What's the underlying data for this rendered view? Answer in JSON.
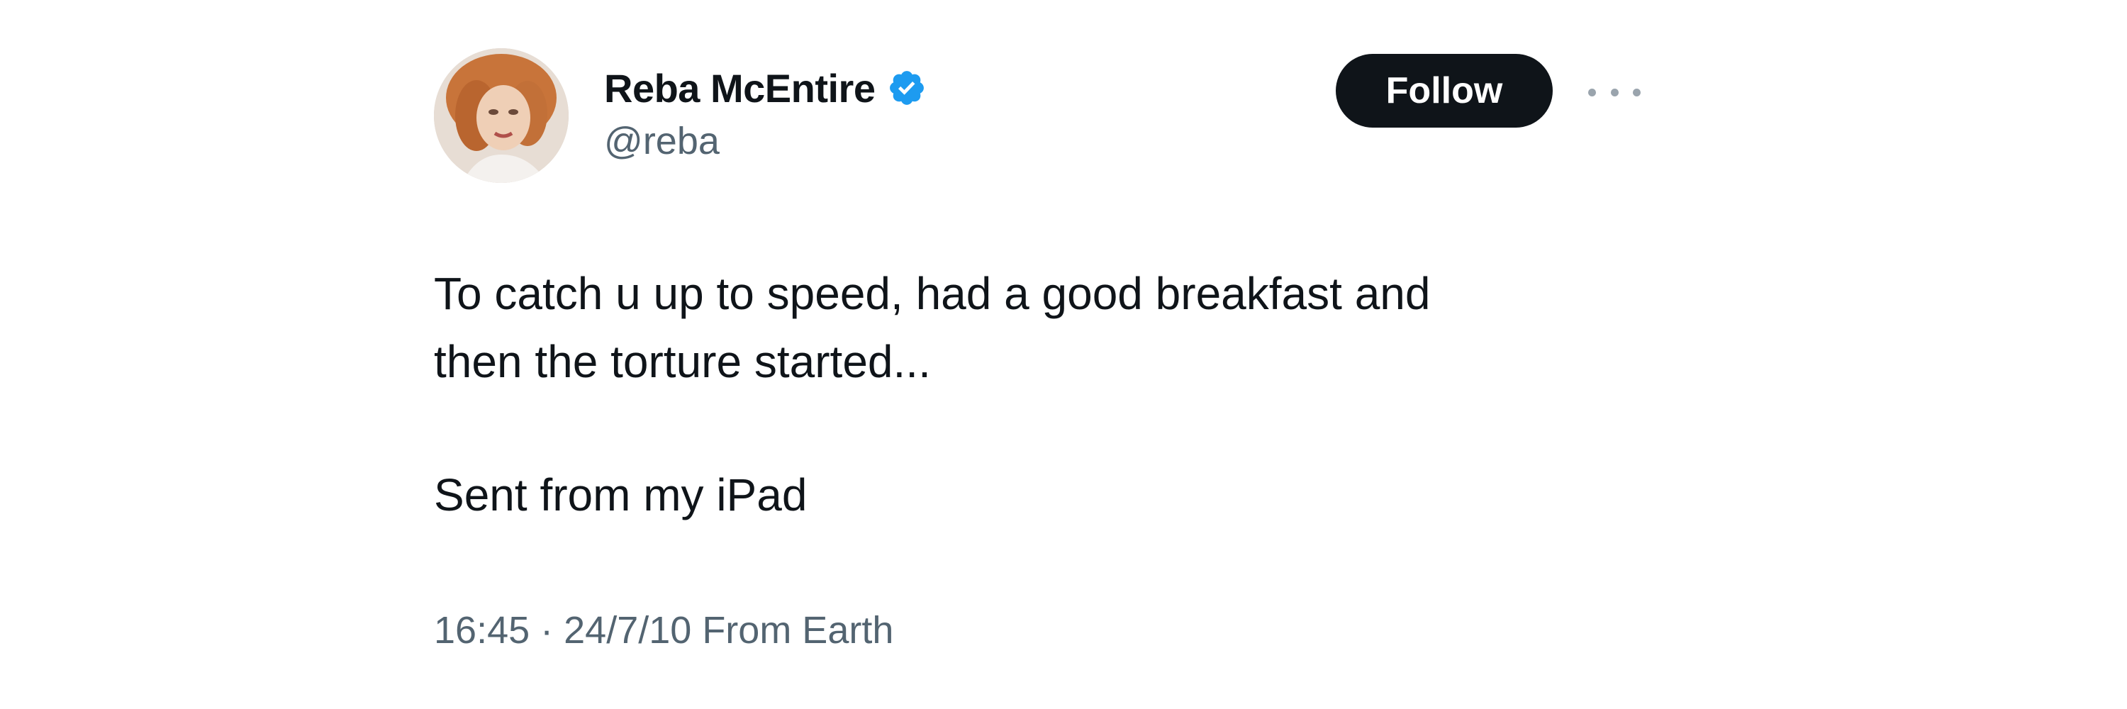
{
  "tweet": {
    "author": {
      "display_name": "Reba McEntire",
      "handle": "@reba",
      "verified": true,
      "avatar": "profile-photo"
    },
    "actions": {
      "follow_label": "Follow",
      "more_icon": "more-horizontal-icon"
    },
    "text": {
      "line1": "To catch u up to speed, had a good breakfast and",
      "line2": "then the torture started...",
      "line3": "Sent from my iPad"
    },
    "meta": {
      "time": "16:45",
      "separator": " · ",
      "date": "24/7/10",
      "source": " From Earth"
    },
    "colors": {
      "verified_badge": "#1d9bf0",
      "follow_button_bg": "#0f1419",
      "secondary_text": "#536471"
    }
  }
}
